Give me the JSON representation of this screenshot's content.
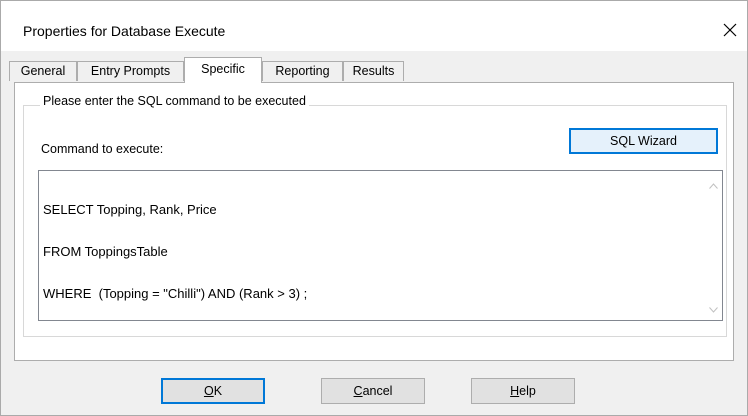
{
  "window": {
    "title": "Properties for Database Execute",
    "close_icon": "close-icon"
  },
  "tabs": [
    {
      "label": "General",
      "active": false
    },
    {
      "label": "Entry Prompts",
      "active": false
    },
    {
      "label": "Specific",
      "active": true
    },
    {
      "label": "Reporting",
      "active": false
    },
    {
      "label": "Results",
      "active": false
    }
  ],
  "panel": {
    "group_title": "Please enter the SQL command to be executed",
    "command_label": "Command to execute:",
    "sql_wizard_label": "SQL Wizard",
    "sql_lines": [
      "SELECT Topping, Rank, Price",
      "FROM ToppingsTable",
      "WHERE  (Topping = \"Chilli\") AND (Rank > 3) ;"
    ]
  },
  "buttons": {
    "ok": {
      "mnemonic": "O",
      "rest": "K"
    },
    "cancel": {
      "mnemonic": "C",
      "rest": "ancel"
    },
    "help": {
      "mnemonic": "H",
      "rest": "elp"
    }
  },
  "colors": {
    "accent": "#0078d7",
    "dialog_bg": "#f0f0f0",
    "panel_bg": "#ffffff"
  }
}
